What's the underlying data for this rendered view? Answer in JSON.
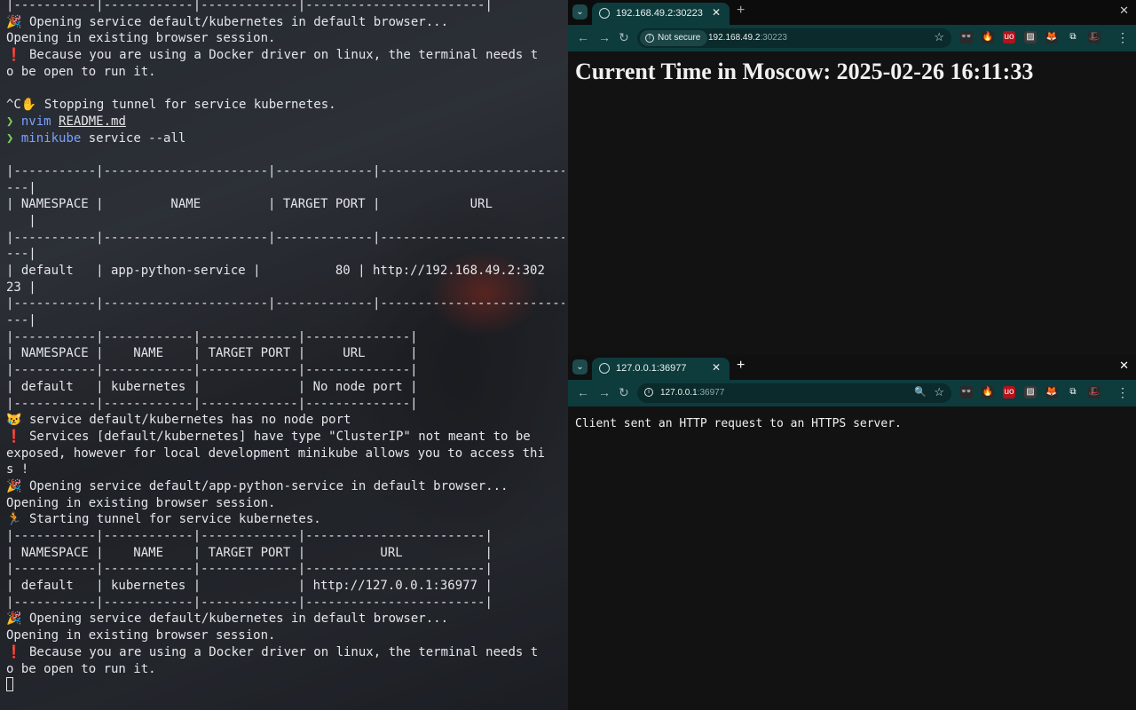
{
  "terminal": {
    "lines": [
      {
        "text": "|-----------|------------|-------------|------------------------|"
      },
      {
        "icon": "🎉",
        "icon_kind": "party",
        "text": "Opening service default/kubernetes in default browser..."
      },
      {
        "text": "Opening in existing browser session."
      },
      {
        "icon": "❗",
        "icon_kind": "warn",
        "text": "Because you are using a Docker driver on linux, the terminal needs t"
      },
      {
        "text": "o be open to run it."
      },
      {
        "text": ""
      },
      {
        "prefix": "^C",
        "icon": "✋",
        "icon_kind": "hand",
        "text": "Stopping tunnel for service kubernetes."
      },
      {
        "prompt": "❯",
        "command": "nvim",
        "args": "README.md",
        "args_underline": true
      },
      {
        "prompt": "❯",
        "command": "minikube",
        "args": "service --all"
      },
      {
        "text": ""
      },
      {
        "text": "|-----------|----------------------|-------------|---------------------------"
      },
      {
        "text": "---|"
      },
      {
        "text": "| NAMESPACE |         NAME         | TARGET PORT |            URL"
      },
      {
        "text": "   |"
      },
      {
        "text": "|-----------|----------------------|-------------|---------------------------"
      },
      {
        "text": "---|"
      },
      {
        "text": "| default   | app-python-service |          80 | http://192.168.49.2:302"
      },
      {
        "text": "23 |"
      },
      {
        "text": "|-----------|----------------------|-------------|---------------------------"
      },
      {
        "text": "---|"
      },
      {
        "text": "|-----------|------------|-------------|--------------|"
      },
      {
        "text": "| NAMESPACE |    NAME    | TARGET PORT |     URL      |"
      },
      {
        "text": "|-----------|------------|-------------|--------------|"
      },
      {
        "text": "| default   | kubernetes |             | No node port |"
      },
      {
        "text": "|-----------|------------|-------------|--------------|"
      },
      {
        "icon": "😿",
        "icon_kind": "cat",
        "text": "service default/kubernetes has no node port"
      },
      {
        "icon": "❗",
        "icon_kind": "warn",
        "text": "Services [default/kubernetes] have type \"ClusterIP\" not meant to be"
      },
      {
        "text": "exposed, however for local development minikube allows you to access thi"
      },
      {
        "text": "s !"
      },
      {
        "icon": "🎉",
        "icon_kind": "party",
        "text": "Opening service default/app-python-service in default browser..."
      },
      {
        "text": "Opening in existing browser session."
      },
      {
        "icon": "🏃",
        "icon_kind": "run",
        "text": "Starting tunnel for service kubernetes."
      },
      {
        "text": "|-----------|------------|-------------|------------------------|"
      },
      {
        "text": "| NAMESPACE |    NAME    | TARGET PORT |          URL           |"
      },
      {
        "text": "|-----------|------------|-------------|------------------------|"
      },
      {
        "text": "| default   | kubernetes |             | http://127.0.0.1:36977 |"
      },
      {
        "text": "|-----------|------------|-------------|------------------------|"
      },
      {
        "icon": "🎉",
        "icon_kind": "party",
        "text": "Opening service default/kubernetes in default browser..."
      },
      {
        "text": "Opening in existing browser session."
      },
      {
        "icon": "❗",
        "icon_kind": "warn",
        "text": "Because you are using a Docker driver on linux, the terminal needs t"
      },
      {
        "text": "o be open to run it."
      },
      {
        "cursor": true
      }
    ]
  },
  "browser_top": {
    "tab_title": "192.168.49.2:30223",
    "security_label": "Not secure",
    "url_host": "192.168.49.2",
    "url_port": ":30223",
    "heading": "Current Time in Moscow: 2025-02-26 16:11:33"
  },
  "browser_bottom": {
    "tab_title": "127.0.0.1:36977",
    "url_host": "127.0.0.1",
    "url_port": ":36977",
    "body_text": "Client sent an HTTP request to an HTTPS server."
  },
  "extensions": [
    {
      "name": "incognito-glasses-icon",
      "glyph": "👓",
      "color": "#2a2a2a"
    },
    {
      "name": "fire-icon",
      "glyph": "🔥",
      "color": "#2a2a2a"
    },
    {
      "name": "ublock-icon",
      "glyph": "uo",
      "color": "#b3121b"
    },
    {
      "name": "stripes-icon",
      "glyph": "▨",
      "color": "#3a3a3a"
    },
    {
      "name": "metamask-fox-icon",
      "glyph": "🦊",
      "color": "#2a2a2a"
    },
    {
      "name": "puzzle-extensions-icon",
      "glyph": "⧉",
      "color": "#0e3b3c"
    },
    {
      "name": "profile-avatar-icon",
      "glyph": "🎩",
      "color": "#2a2a2a"
    }
  ],
  "colors": {
    "accent": "#0e3b3c",
    "terminal_prompt": "#7fd35a",
    "terminal_command": "#7aa0ff"
  }
}
